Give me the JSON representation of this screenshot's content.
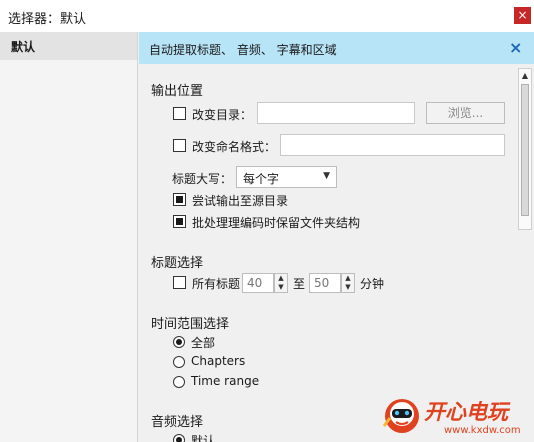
{
  "window": {
    "title": "选择器：默认",
    "close": "×"
  },
  "sidebar": {
    "items": [
      {
        "label": "默认"
      }
    ]
  },
  "banner": {
    "text": "自动提取标题、 音频、 字幕和区域",
    "close": "×"
  },
  "output": {
    "heading": "输出位置",
    "change_dir": {
      "label": "改变目录：",
      "checked": false,
      "value": ""
    },
    "browse_label": "浏览...",
    "change_name": {
      "label": "改变命名格式：",
      "checked": false,
      "value": ""
    },
    "title_case_label": "标题大写：",
    "title_case_value": "每个字",
    "try_source": {
      "label": "尝试输出至源目录",
      "checked": true
    },
    "keep_structure": {
      "label": "批处理理编码时保留文件夹结构",
      "checked": true
    }
  },
  "title_select": {
    "heading": "标题选择",
    "all_titles": {
      "label": "所有标题",
      "checked": false
    },
    "from": "40",
    "to_label": "至",
    "to": "50",
    "unit": "分钟"
  },
  "time_range": {
    "heading": "时间范围选择",
    "options": [
      {
        "label": "全部",
        "selected": true
      },
      {
        "label": "Chapters",
        "selected": false
      },
      {
        "label": "Time range",
        "selected": false
      }
    ]
  },
  "audio": {
    "heading": "音频选择",
    "first_option": "默认"
  },
  "watermark": {
    "text": "开心电玩",
    "url": "www.kxdw.com"
  },
  "colors": {
    "banner": "#b8e4f7",
    "close": "#c62828",
    "accent": "#1b6ab8",
    "watermark": "#e0411f"
  }
}
